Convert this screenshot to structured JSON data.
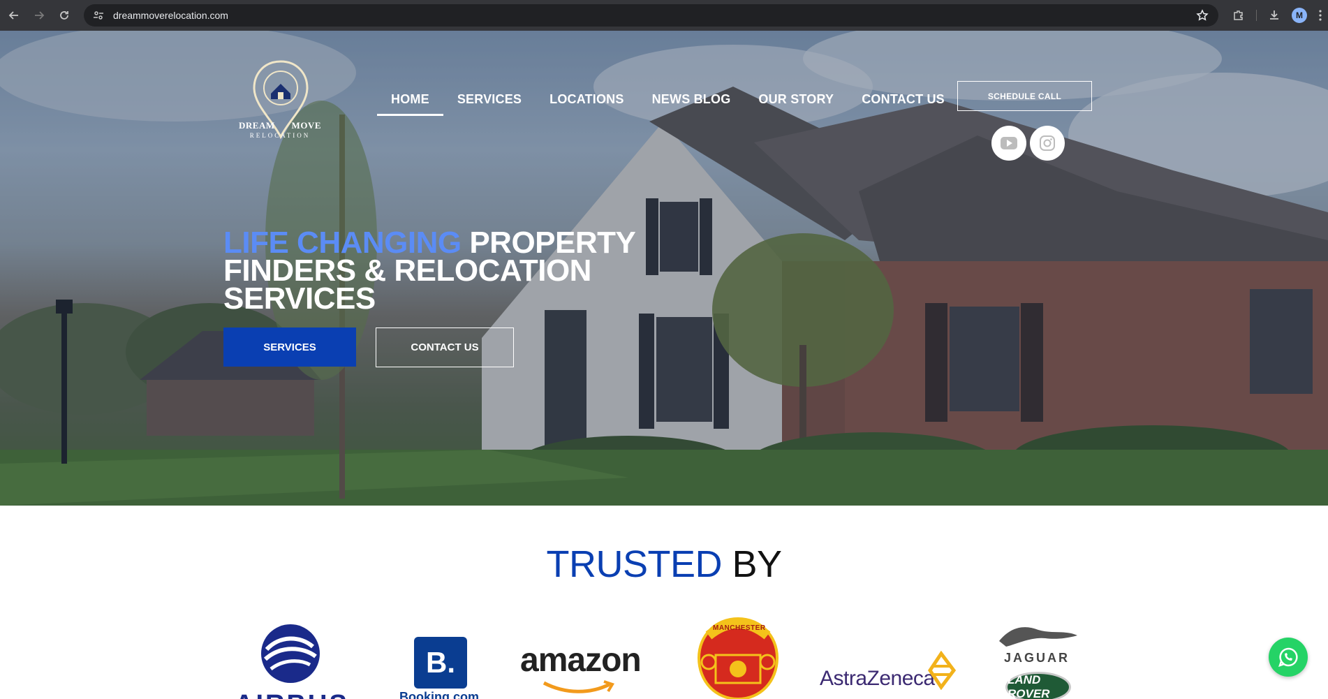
{
  "browser": {
    "url": "dreammoverelocation.com",
    "profile_initial": "M",
    "icons": [
      "back-icon",
      "forward-icon",
      "reload-icon",
      "site-settings-icon",
      "bookmark-star-icon",
      "extensions-icon",
      "download-icon",
      "menu-icon"
    ]
  },
  "logo": {
    "word1": "DREAM",
    "word2": "MOVE",
    "word3": "RELOCATION"
  },
  "nav": {
    "items": [
      {
        "label": "HOME",
        "active": true
      },
      {
        "label": "SERVICES",
        "active": false
      },
      {
        "label": "LOCATIONS",
        "active": false
      },
      {
        "label": "NEWS BLOG",
        "active": false
      },
      {
        "label": "OUR STORY",
        "active": false
      },
      {
        "label": "CONTACT US",
        "active": false
      }
    ],
    "schedule_label": "SCHEDULE CALL",
    "social": [
      "youtube-icon",
      "instagram-icon"
    ]
  },
  "hero": {
    "headline_accent": "LIFE CHANGING",
    "headline_rest_line1": " PROPERTY",
    "headline_line2": "FINDERS & RELOCATION",
    "headline_line3": "SERVICES",
    "primary_button": "SERVICES",
    "secondary_button": "CONTACT US"
  },
  "trusted": {
    "title_blue": "TRUSTED",
    "title_black": " BY",
    "logos": [
      {
        "name": "Airbus",
        "text": "AIRBUS"
      },
      {
        "name": "Booking.com",
        "text": "B.",
        "subtext": "Booking.com"
      },
      {
        "name": "Amazon",
        "text": "amazon"
      },
      {
        "name": "Manchester United",
        "text": "MANCHESTER"
      },
      {
        "name": "AstraZeneca",
        "text": "AstraZeneca"
      },
      {
        "name": "Jaguar Land Rover",
        "text": "JAGUAR",
        "subtext": "LAND ROVER"
      }
    ]
  },
  "colors": {
    "brand_blue": "#0a3fb2",
    "accent_light_blue": "#5b8cf5",
    "whatsapp_green": "#25d366"
  }
}
